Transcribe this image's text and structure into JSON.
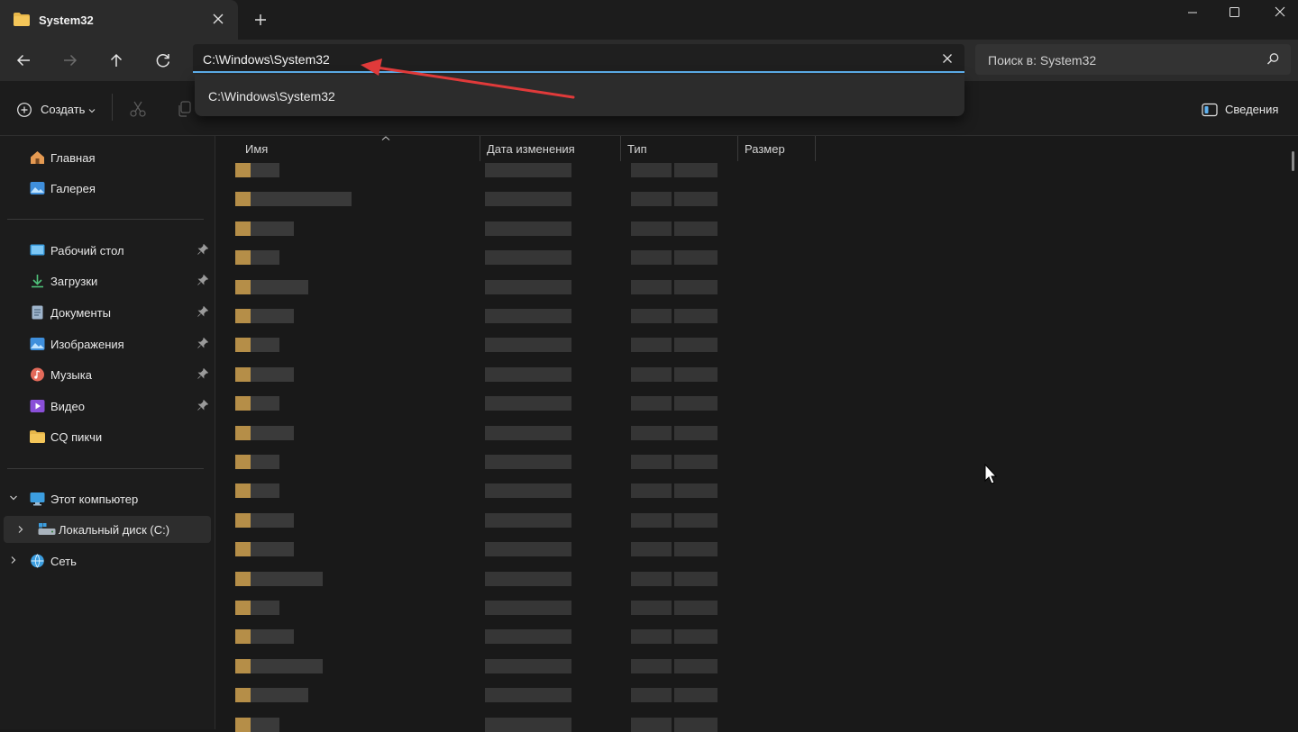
{
  "window": {
    "tab_title": "System32",
    "new_tab_label": "+"
  },
  "navigation": {
    "address": "C:\\Windows\\System32",
    "search_placeholder": "Поиск в: System32",
    "suggestion": "C:\\Windows\\System32"
  },
  "commandbar": {
    "create_label": "Создать",
    "details_label": "Сведения"
  },
  "sidebar": {
    "quick": [
      {
        "label": "Главная",
        "icon": "home-icon"
      },
      {
        "label": "Галерея",
        "icon": "gallery-icon"
      }
    ],
    "pinned": [
      {
        "label": "Рабочий стол",
        "icon": "desktop-icon"
      },
      {
        "label": "Загрузки",
        "icon": "downloads-icon"
      },
      {
        "label": "Документы",
        "icon": "documents-icon"
      },
      {
        "label": "Изображения",
        "icon": "pictures-icon"
      },
      {
        "label": "Музыка",
        "icon": "music-icon"
      },
      {
        "label": "Видео",
        "icon": "video-icon"
      },
      {
        "label": "CQ пикчи",
        "icon": "folder-icon"
      }
    ],
    "this_pc": "Этот компьютер",
    "local_disk": "Локальный диск (C:)",
    "network": "Сеть"
  },
  "columns": {
    "name": "Имя",
    "date": "Дата изменения",
    "type": "Тип",
    "size": "Размер"
  },
  "colors": {
    "accent": "#5fb2f0",
    "annotation_arrow": "#e03a3a",
    "folder": "#b58e48"
  }
}
